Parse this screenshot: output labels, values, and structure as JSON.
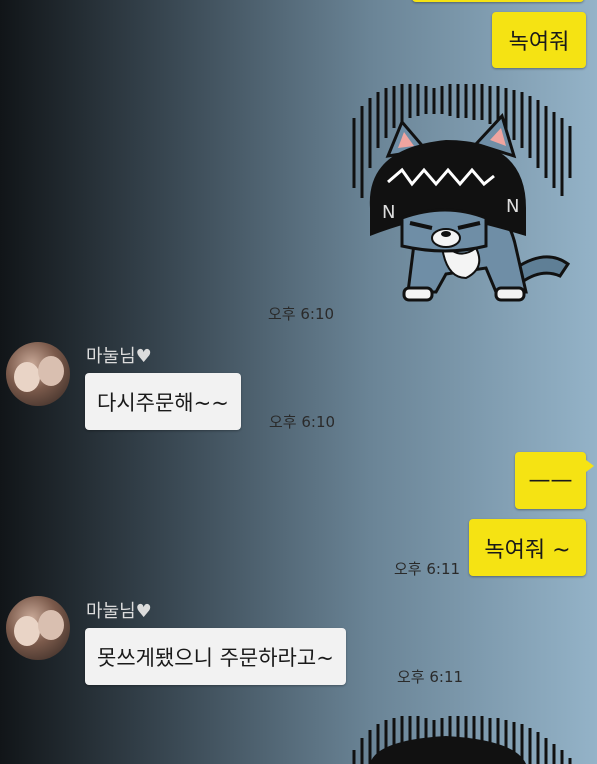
{
  "messages": {
    "m1_text": "녹여줘",
    "m2_time": "오후 6:10",
    "m3_name": "마눌님♥",
    "m3_text": "다시주문해~~",
    "m3_time": "오후 6:10",
    "m4_text": "——",
    "m5_text": "녹여줘 ~",
    "m5_time": "오후 6:11",
    "m6_name": "마눌님♥",
    "m6_text": "못쓰게됐으니 주문하라고~",
    "m6_time": "오후 6:11"
  },
  "colors": {
    "my_bubble": "#f5e313",
    "their_bubble": "#f2f2f2"
  },
  "icons": {
    "sticker": "angry-cat-sticker-icon",
    "avatar": "profile-avatar-icon"
  }
}
